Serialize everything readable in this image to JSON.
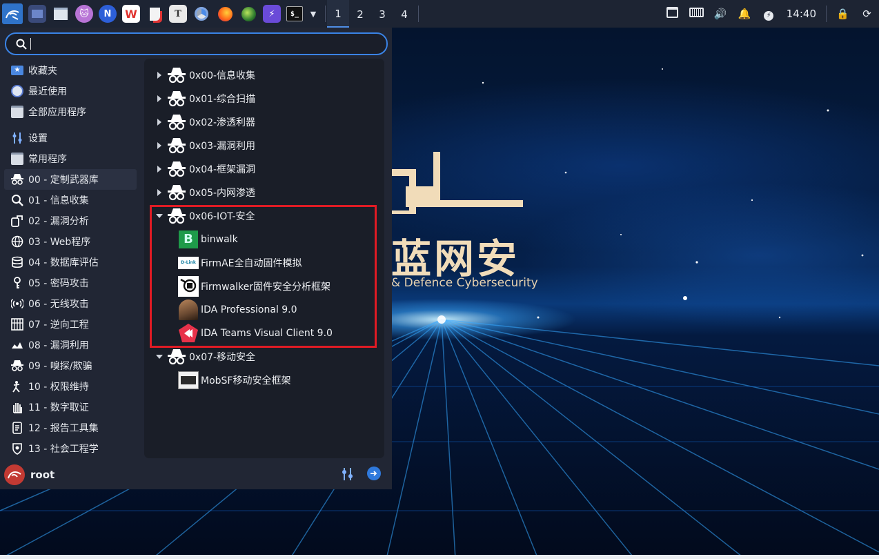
{
  "taskbar": {
    "workspaces": [
      "1",
      "2",
      "3",
      "4"
    ],
    "active_workspace": "1",
    "clock": "14:40",
    "app_icons": [
      "kali-menu-icon",
      "desktop-icon",
      "file-manager-icon",
      "cat-icon",
      "n-browser-icon",
      "wps-icon",
      "document-viewer-icon",
      "text-editor-icon",
      "chrome-icon",
      "firefox-icon",
      "globe-tool-icon",
      "burp-icon",
      "terminal-icon",
      "chevron-down-icon"
    ],
    "tray_icons": [
      "window-list-icon",
      "keyboard-icon",
      "volume-icon",
      "notification-bell-icon",
      "power-manager-icon",
      "lock-icon",
      "restart-icon"
    ],
    "wps_label": "W",
    "text_editor_label": "T",
    "n_label": "N"
  },
  "search": {
    "placeholder": "",
    "value": ""
  },
  "sidebar": {
    "top_items": [
      {
        "label": "收藏夹",
        "icon": "star-folder-icon"
      },
      {
        "label": "最近使用",
        "icon": "recent-icon"
      },
      {
        "label": "全部应用程序",
        "icon": "all-apps-icon"
      }
    ],
    "items": [
      {
        "label": "设置",
        "icon": "settings-icon"
      },
      {
        "label": "常用程序",
        "icon": "common-apps-icon"
      },
      {
        "label": "00 - 定制武器库",
        "icon": "spy-icon",
        "selected": true
      },
      {
        "label": "01 - 信息收集",
        "icon": "magnifier-icon"
      },
      {
        "label": "02 - 漏洞分析",
        "icon": "vuln-analysis-icon"
      },
      {
        "label": "03 - Web程序",
        "icon": "web-icon"
      },
      {
        "label": "04 - 数据库评估",
        "icon": "database-icon"
      },
      {
        "label": "05 - 密码攻击",
        "icon": "key-icon"
      },
      {
        "label": "06 - 无线攻击",
        "icon": "wireless-icon"
      },
      {
        "label": "07 - 逆向工程",
        "icon": "reverse-icon"
      },
      {
        "label": "08 - 漏洞利用",
        "icon": "exploit-icon"
      },
      {
        "label": "09 - 嗅探/欺骗",
        "icon": "sniff-icon"
      },
      {
        "label": "10 - 权限维持",
        "icon": "persistence-icon"
      },
      {
        "label": "11 - 数字取证",
        "icon": "hand-icon"
      },
      {
        "label": "12 - 报告工具集",
        "icon": "report-icon"
      },
      {
        "label": "13 - 社会工程学",
        "icon": "social-eng-icon"
      }
    ]
  },
  "app_pane": {
    "folders": [
      {
        "label": "0x00-信息收集",
        "expanded": false
      },
      {
        "label": "0x01-综合扫描",
        "expanded": false
      },
      {
        "label": "0x02-渗透利器",
        "expanded": false
      },
      {
        "label": "0x03-漏洞利用",
        "expanded": false
      },
      {
        "label": "0x04-框架漏洞",
        "expanded": false
      },
      {
        "label": "0x05-内网渗透",
        "expanded": false
      },
      {
        "label": "0x06-IOT-安全",
        "expanded": true
      },
      {
        "label": "0x07-移动安全",
        "expanded": true
      }
    ],
    "iot_apps": [
      {
        "label": "binwalk",
        "icon": "binwalk-icon"
      },
      {
        "label": "FirmAE全自动固件模拟",
        "icon": "dlink-icon"
      },
      {
        "label": "Firmwalker固件安全分析框架",
        "icon": "firmwalker-icon"
      },
      {
        "label": "IDA Professional 9.0",
        "icon": "ida-pro-icon"
      },
      {
        "label": "IDA Teams Visual Client 9.0",
        "icon": "ida-teams-icon"
      }
    ],
    "mobile_apps": [
      {
        "label": "MobSF移动安全框架",
        "icon": "mobsf-icon"
      }
    ],
    "dlink_text": "D-Link"
  },
  "footer": {
    "user": "root"
  },
  "wallpaper": {
    "title": "蓝网安",
    "subtitle": "& Defence Cybersecurity"
  },
  "colors": {
    "accent": "#3a83e6",
    "highlight": "#e01b24",
    "menu_bg": "#212634",
    "taskbar_bg": "#1d2433"
  }
}
